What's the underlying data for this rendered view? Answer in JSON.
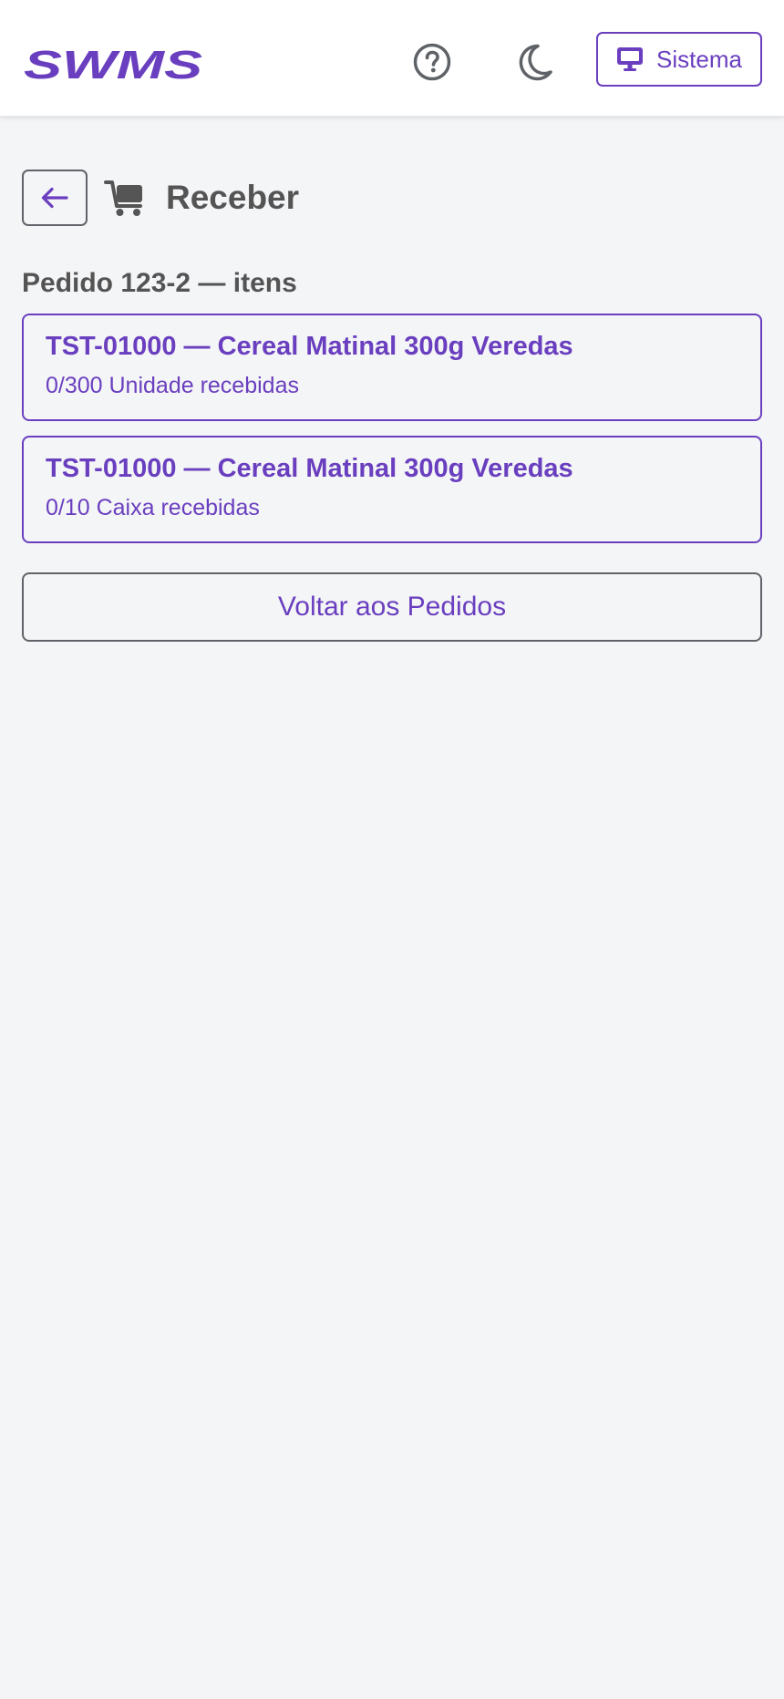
{
  "header": {
    "logo_text": "SWMS",
    "system_label": "Sistema",
    "colors": {
      "accent": "#6a3fbf",
      "icon_gray": "#5f6368"
    }
  },
  "page": {
    "title": "Receber",
    "section_title": "Pedido 123-2 — itens",
    "items": [
      {
        "title": "TST-01000 — Cereal Matinal 300g Veredas",
        "status": "0/300 Unidade recebidas"
      },
      {
        "title": "TST-01000 — Cereal Matinal 300g Veredas",
        "status": "0/10 Caixa recebidas"
      }
    ],
    "return_label": "Voltar aos Pedidos"
  },
  "icons": {
    "back": "arrow-left-icon",
    "cart": "cart-icon",
    "help": "question-circle-icon",
    "theme": "moon-icon",
    "system": "monitor-icon"
  }
}
